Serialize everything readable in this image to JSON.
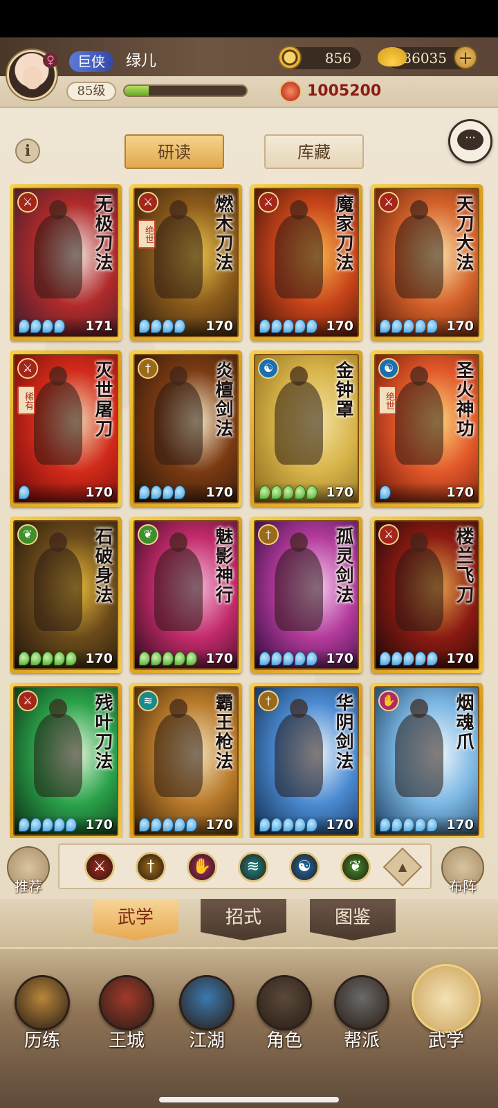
{
  "player": {
    "gender_symbol": "♀",
    "title": "巨侠",
    "name": "绿儿",
    "level": "85级",
    "exp_fraction": 0.2
  },
  "currencies": {
    "coins": "856",
    "ingots": "36035",
    "plus_symbol": "+"
  },
  "combat_power": "1005200",
  "info_symbol": "i",
  "chat_symbol": "···",
  "tabs": {
    "study": "研读",
    "storage": "库藏"
  },
  "cards": [
    {
      "name": "无极刀法",
      "level": "171",
      "stars": 4,
      "star_color": "blue",
      "type_icon": "blade-icon",
      "type_color": "#a2261c",
      "rarity": "",
      "bg": [
        "#3a1d2e",
        "#b02a2a",
        "#f2e6e0"
      ]
    },
    {
      "name": "燃木刀法",
      "level": "170",
      "stars": 4,
      "star_color": "blue",
      "type_icon": "blade-icon",
      "type_color": "#a2261c",
      "rarity": "绝世",
      "bg": [
        "#2a1a10",
        "#8a5a1a",
        "#e8c04a"
      ]
    },
    {
      "name": "魔家刀法",
      "level": "170",
      "stars": 5,
      "star_color": "blue",
      "type_icon": "blade-icon",
      "type_color": "#a2261c",
      "rarity": "",
      "bg": [
        "#3a1208",
        "#c8441a",
        "#f7b24a"
      ]
    },
    {
      "name": "天刀大法",
      "level": "170",
      "stars": 5,
      "star_color": "blue",
      "type_icon": "blade-icon",
      "type_color": "#a2261c",
      "rarity": "",
      "bg": [
        "#5a1a0a",
        "#d4622a",
        "#fbe2a8"
      ]
    },
    {
      "name": "灭世屠刀",
      "level": "170",
      "stars": 1,
      "star_color": "blue",
      "type_icon": "blade-icon",
      "type_color": "#a2261c",
      "rarity": "稀有",
      "bg": [
        "#6a0a0a",
        "#d22a1a",
        "#f0d4b0"
      ]
    },
    {
      "name": "炎檀剑法",
      "level": "170",
      "stars": 4,
      "star_color": "blue",
      "type_icon": "sword-icon",
      "type_color": "#9a6a1a",
      "rarity": "",
      "bg": [
        "#2a1608",
        "#7a3a12",
        "#f6e8c8"
      ]
    },
    {
      "name": "金钟罩",
      "level": "170",
      "stars": 5,
      "star_color": "green",
      "type_icon": "yin-yang-icon",
      "type_color": "#1b6fb0",
      "rarity": "",
      "bg": [
        "#8a6a1a",
        "#d8b44a",
        "#f4e3a2"
      ]
    },
    {
      "name": "圣火神功",
      "level": "170",
      "stars": 1,
      "star_color": "blue",
      "type_icon": "yin-yang-icon",
      "type_color": "#1b6fb0",
      "rarity": "绝世",
      "bg": [
        "#6a1608",
        "#e2582a",
        "#fbd27a"
      ]
    },
    {
      "name": "石破身法",
      "level": "170",
      "stars": 5,
      "star_color": "green",
      "type_icon": "leaf-icon",
      "type_color": "#3f8f2a",
      "rarity": "",
      "bg": [
        "#1e140a",
        "#6a4a1a",
        "#e6b838"
      ]
    },
    {
      "name": "魅影神行",
      "level": "170",
      "stars": 5,
      "star_color": "green",
      "type_icon": "leaf-icon",
      "type_color": "#3f8f2a",
      "rarity": "",
      "bg": [
        "#2a0a1a",
        "#c22a6a",
        "#f4b6d6"
      ]
    },
    {
      "name": "孤灵剑法",
      "level": "170",
      "stars": 5,
      "star_color": "blue",
      "type_icon": "sword-icon",
      "type_color": "#9a6a1a",
      "rarity": "",
      "bg": [
        "#2a0a3a",
        "#b23a9a",
        "#f6c8f0"
      ]
    },
    {
      "name": "楼兰飞刀",
      "level": "170",
      "stars": 5,
      "star_color": "blue",
      "type_icon": "blade-icon",
      "type_color": "#a2261c",
      "rarity": "",
      "bg": [
        "#1a0808",
        "#8a1a12",
        "#e4a24a"
      ]
    },
    {
      "name": "残叶刀法",
      "level": "170",
      "stars": 5,
      "star_color": "blue",
      "type_icon": "blade-icon",
      "type_color": "#a2261c",
      "rarity": "",
      "bg": [
        "#0a2a12",
        "#2aa24a",
        "#e2f4d8"
      ]
    },
    {
      "name": "霸王枪法",
      "level": "170",
      "stars": 5,
      "star_color": "blue",
      "type_icon": "fan-icon",
      "type_color": "#1a8a8a",
      "rarity": "",
      "bg": [
        "#3a220a",
        "#b87a2a",
        "#f2e0b8"
      ]
    },
    {
      "name": "华阴剑法",
      "level": "170",
      "stars": 5,
      "star_color": "blue",
      "type_icon": "sword-icon",
      "type_color": "#9a6a1a",
      "rarity": "",
      "bg": [
        "#102a4a",
        "#4a8ad2",
        "#eef4fb"
      ]
    },
    {
      "name": "烟魂爪",
      "level": "170",
      "stars": 5,
      "star_color": "blue",
      "type_icon": "claw-icon",
      "type_color": "#b02a6a",
      "rarity": "",
      "bg": [
        "#1a3a5a",
        "#7ab6e2",
        "#f2f8fc"
      ]
    }
  ],
  "filters": [
    {
      "name": "blade-filter-icon",
      "color": "#a2261c",
      "glyph": "⚔"
    },
    {
      "name": "sword-filter-icon",
      "color": "#9a6a1a",
      "glyph": "†"
    },
    {
      "name": "claw-filter-icon",
      "color": "#b02a6a",
      "glyph": "✋"
    },
    {
      "name": "fan-filter-icon",
      "color": "#1a8a8a",
      "glyph": "≋"
    },
    {
      "name": "yin-yang-filter-icon",
      "color": "#1b6fb0",
      "glyph": "☯"
    },
    {
      "name": "leaf-filter-icon",
      "color": "#3f8f2a",
      "glyph": "❦"
    }
  ],
  "filter_arrow_glyph": "▲",
  "side_buttons": {
    "recommend": "推荐",
    "formation": "布阵"
  },
  "section_tabs": [
    "武学",
    "招式",
    "图鉴"
  ],
  "nav": [
    {
      "label": "历练",
      "icon": "training-icon",
      "color": "#b8863a"
    },
    {
      "label": "王城",
      "icon": "palace-icon",
      "color": "#a23a2a"
    },
    {
      "label": "江湖",
      "icon": "jianghu-icon",
      "color": "#3a7ab0"
    },
    {
      "label": "角色",
      "icon": "character-icon",
      "color": "#5a4a3a"
    },
    {
      "label": "帮派",
      "icon": "guild-icon",
      "color": "#6a6a6a"
    },
    {
      "label": "武学",
      "icon": "martial-scroll-icon",
      "color": "#c8a25a"
    }
  ]
}
